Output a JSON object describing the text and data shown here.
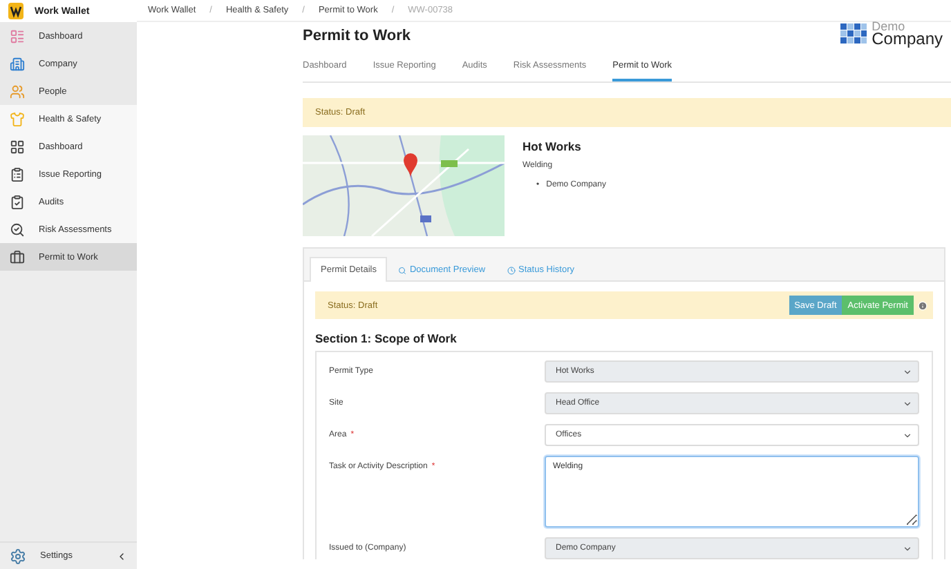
{
  "app": {
    "name": "Work Wallet"
  },
  "breadcrumbs": {
    "separator": "/",
    "items": [
      "Work Wallet",
      "Health & Safety",
      "Permit to Work",
      "WW-00738"
    ]
  },
  "sidebar": {
    "items": [
      {
        "label": "Dashboard",
        "kind": "module",
        "selected": false
      },
      {
        "label": "Company",
        "kind": "module",
        "selected": false
      },
      {
        "label": "People",
        "kind": "module",
        "selected": false
      },
      {
        "label": "Health & Safety",
        "kind": "section",
        "selected": false
      },
      {
        "label": "Dashboard",
        "kind": "sub",
        "selected": false
      },
      {
        "label": "Issue Reporting",
        "kind": "sub",
        "selected": false
      },
      {
        "label": "Audits",
        "kind": "sub",
        "selected": false
      },
      {
        "label": "Risk Assessments",
        "kind": "sub",
        "selected": false
      },
      {
        "label": "Permit to Work",
        "kind": "sub",
        "selected": true
      }
    ],
    "footer": {
      "label": "Settings"
    }
  },
  "logo": {
    "line_1": "Demo",
    "line_2": "Company"
  },
  "page_title": "Permit to Work",
  "tabs": [
    {
      "label": "Dashboard",
      "selected": false
    },
    {
      "label": "Issue Reporting",
      "selected": false
    },
    {
      "label": "Audits",
      "selected": false
    },
    {
      "label": "Risk Assessments",
      "selected": false
    },
    {
      "label": "Permit to Work",
      "selected": true
    }
  ],
  "status_banner": "Status: Draft",
  "summary": {
    "title": "Hot Works",
    "subtitle": "Welding",
    "bullets": [
      {
        "marker": "•",
        "text": "Demo Company"
      }
    ]
  },
  "card_tabs": [
    {
      "label": "Permit Details",
      "selected": true
    },
    {
      "label": "Document Preview",
      "selected": false
    },
    {
      "label": "Status History",
      "selected": false
    }
  ],
  "card_status": "Status: Draft",
  "buttons": [
    {
      "label": "Save Draft",
      "kind": "info"
    },
    {
      "label": "Activate Permit",
      "kind": "success"
    }
  ],
  "section_title": "Section 1: Scope of Work",
  "fields": [
    {
      "label": "Permit Type",
      "kind": "select",
      "value": "Hot Works",
      "disabled": true
    },
    {
      "label": "Site",
      "kind": "select",
      "value": "Head Office",
      "disabled": true
    },
    {
      "label": "Area",
      "required_mark": "*",
      "kind": "select",
      "value": "Offices",
      "disabled": false
    },
    {
      "label": "Task or Activity Description",
      "required_mark": "*",
      "kind": "textarea",
      "value": "Welding",
      "disabled": false
    },
    {
      "label": "Issued to (Company)",
      "kind": "select",
      "value": "Demo Company",
      "disabled": true
    }
  ]
}
